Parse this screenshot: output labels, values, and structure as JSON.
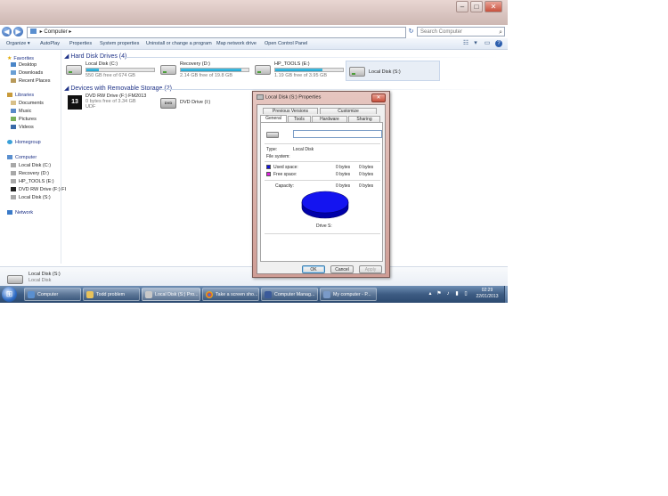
{
  "colors": {
    "used_space": "#1010e0",
    "free_space": "#e020e0",
    "drive_bar": "#26a7d4",
    "title_bar": "#d8c3bf",
    "taskbar": "#3d5c83",
    "heading": "#1e3287"
  },
  "window": {
    "address_path": "Computer",
    "search_placeholder": "Search Computer",
    "controls": {
      "minimize": "–",
      "maximize": "□",
      "close": "✕"
    }
  },
  "toolbar": {
    "organize": "Organize ▾",
    "autoplay": "AutoPlay",
    "properties": "Properties",
    "system_properties": "System properties",
    "uninstall": "Uninstall or change a program",
    "map_network": "Map network drive",
    "control_panel": "Open Control Panel"
  },
  "nav": {
    "favorites": "Favorites",
    "desktop": "Desktop",
    "downloads": "Downloads",
    "recent": "Recent Places",
    "libraries": "Libraries",
    "documents": "Documents",
    "music": "Music",
    "pictures": "Pictures",
    "videos": "Videos",
    "homegroup": "Homegroup",
    "computer": "Computer",
    "drive_c": "Local Disk (C:)",
    "drive_d": "Recovery (D:)",
    "drive_e": "HP_TOOLS (E:)",
    "drive_f": "DVD RW Drive (F:) FI",
    "drive_s": "Local Disk (S:)",
    "network": "Network"
  },
  "content": {
    "hdd_header": "Hard Disk Drives (4)",
    "removable_header": "Devices with Removable Storage (2)",
    "drives": [
      {
        "name": "Local Disk (C:)",
        "free": "550 GB free of 674 GB",
        "used_fraction": 0.18
      },
      {
        "name": "Recovery (D:)",
        "free": "2.14 GB free of 19.8 GB",
        "used_fraction": 0.89
      },
      {
        "name": "HP_TOOLS (E:)",
        "free": "1.19 GB free of 3.95 GB",
        "used_fraction": 0.7
      },
      {
        "name": "Local Disk (S:)"
      }
    ],
    "dvd_f": {
      "name": "DVD RW Drive (F:) FM2013",
      "free": "0 bytes free of 3.34 GB",
      "fs": "UDF"
    },
    "dvd_i": {
      "name": "DVD Drive (I:)"
    }
  },
  "details": {
    "name": "Local Disk (S:)",
    "type": "Local Disk"
  },
  "taskbar": {
    "start": "⊞",
    "tasks": [
      {
        "label": "Computer"
      },
      {
        "label": "Todd problem"
      },
      {
        "label": "Local Disk (S:) Pro..."
      },
      {
        "label": "Take a screen sho..."
      },
      {
        "label": "Computer Manag..."
      },
      {
        "label": "My computer - P..."
      }
    ],
    "time": "02:29",
    "date": "22/01/2013"
  },
  "dialog": {
    "title": "Local Disk (S:) Properties",
    "close": "✕",
    "tabs_row1": [
      "Previous Versions",
      "Customize"
    ],
    "tabs_row2": [
      "General",
      "Tools",
      "Hardware",
      "Sharing"
    ],
    "type_label": "Type:",
    "type_value": "Local Disk",
    "fs_label": "File system:",
    "used_label": "Used space:",
    "used_bytes": "0 bytes",
    "used_size": "0 bytes",
    "free_label": "Free space:",
    "free_bytes": "0 bytes",
    "free_size": "0 bytes",
    "capacity_label": "Capacity:",
    "capacity_bytes": "0 bytes",
    "capacity_size": "0 bytes",
    "drive_label": "Drive S:",
    "ok": "OK",
    "cancel": "Cancel",
    "apply": "Apply"
  }
}
